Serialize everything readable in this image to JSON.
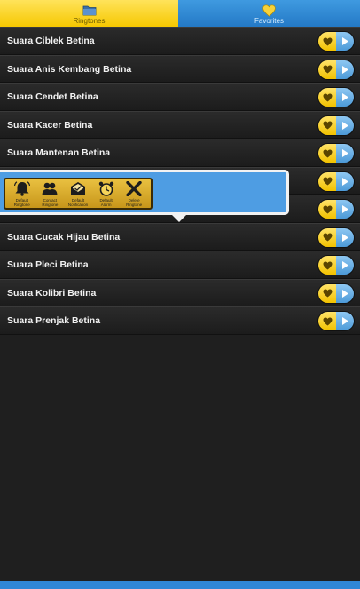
{
  "tabs": [
    {
      "label": "Ringtones",
      "icon": "folder-icon",
      "selected": true
    },
    {
      "label": "Favorites",
      "icon": "heart-icon",
      "selected": false
    }
  ],
  "list": {
    "items": [
      {
        "title": "Suara Ciblek Betina"
      },
      {
        "title": "Suara Anis Kembang Betina"
      },
      {
        "title": "Suara Cendet Betina"
      },
      {
        "title": "Suara Kacer Betina"
      },
      {
        "title": "Suara Mantenan Betina"
      },
      {
        "title": ""
      },
      {
        "title": ""
      },
      {
        "title": "Suara Cucak Hijau Betina"
      },
      {
        "title": "Suara Pleci Betina"
      },
      {
        "title": "Suara Kolibri Betina"
      },
      {
        "title": "Suara Prenjak Betina"
      }
    ]
  },
  "popup": {
    "actions": [
      {
        "label": "Default\nRingtone",
        "icon": "ringtone-bell-icon"
      },
      {
        "label": "Contact\nRingtone",
        "icon": "contact-icon"
      },
      {
        "label": "Default\nNotification",
        "icon": "notification-icon"
      },
      {
        "label": "Default\nAlarm",
        "icon": "alarm-clock-icon"
      },
      {
        "label": "Delete\nRingtone",
        "icon": "close-x-icon"
      }
    ]
  },
  "colors": {
    "tab_selected": "#f6c800",
    "tab_unselected": "#2479c6",
    "popup_bg": "#4e9de3",
    "list_bg": "#1f1f1f"
  }
}
